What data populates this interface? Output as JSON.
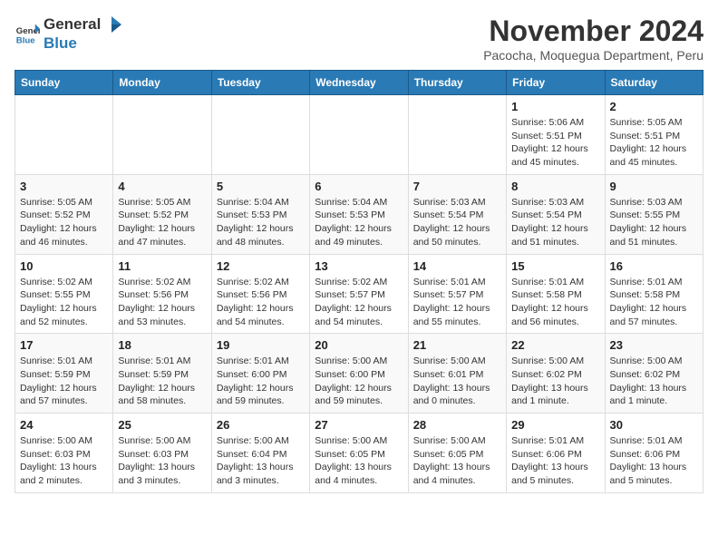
{
  "logo": {
    "general": "General",
    "blue": "Blue"
  },
  "title": "November 2024",
  "subtitle": "Pacocha, Moquegua Department, Peru",
  "days_of_week": [
    "Sunday",
    "Monday",
    "Tuesday",
    "Wednesday",
    "Thursday",
    "Friday",
    "Saturday"
  ],
  "weeks": [
    [
      {
        "day": "",
        "info": ""
      },
      {
        "day": "",
        "info": ""
      },
      {
        "day": "",
        "info": ""
      },
      {
        "day": "",
        "info": ""
      },
      {
        "day": "",
        "info": ""
      },
      {
        "day": "1",
        "info": "Sunrise: 5:06 AM\nSunset: 5:51 PM\nDaylight: 12 hours\nand 45 minutes."
      },
      {
        "day": "2",
        "info": "Sunrise: 5:05 AM\nSunset: 5:51 PM\nDaylight: 12 hours\nand 45 minutes."
      }
    ],
    [
      {
        "day": "3",
        "info": "Sunrise: 5:05 AM\nSunset: 5:52 PM\nDaylight: 12 hours\nand 46 minutes."
      },
      {
        "day": "4",
        "info": "Sunrise: 5:05 AM\nSunset: 5:52 PM\nDaylight: 12 hours\nand 47 minutes."
      },
      {
        "day": "5",
        "info": "Sunrise: 5:04 AM\nSunset: 5:53 PM\nDaylight: 12 hours\nand 48 minutes."
      },
      {
        "day": "6",
        "info": "Sunrise: 5:04 AM\nSunset: 5:53 PM\nDaylight: 12 hours\nand 49 minutes."
      },
      {
        "day": "7",
        "info": "Sunrise: 5:03 AM\nSunset: 5:54 PM\nDaylight: 12 hours\nand 50 minutes."
      },
      {
        "day": "8",
        "info": "Sunrise: 5:03 AM\nSunset: 5:54 PM\nDaylight: 12 hours\nand 51 minutes."
      },
      {
        "day": "9",
        "info": "Sunrise: 5:03 AM\nSunset: 5:55 PM\nDaylight: 12 hours\nand 51 minutes."
      }
    ],
    [
      {
        "day": "10",
        "info": "Sunrise: 5:02 AM\nSunset: 5:55 PM\nDaylight: 12 hours\nand 52 minutes."
      },
      {
        "day": "11",
        "info": "Sunrise: 5:02 AM\nSunset: 5:56 PM\nDaylight: 12 hours\nand 53 minutes."
      },
      {
        "day": "12",
        "info": "Sunrise: 5:02 AM\nSunset: 5:56 PM\nDaylight: 12 hours\nand 54 minutes."
      },
      {
        "day": "13",
        "info": "Sunrise: 5:02 AM\nSunset: 5:57 PM\nDaylight: 12 hours\nand 54 minutes."
      },
      {
        "day": "14",
        "info": "Sunrise: 5:01 AM\nSunset: 5:57 PM\nDaylight: 12 hours\nand 55 minutes."
      },
      {
        "day": "15",
        "info": "Sunrise: 5:01 AM\nSunset: 5:58 PM\nDaylight: 12 hours\nand 56 minutes."
      },
      {
        "day": "16",
        "info": "Sunrise: 5:01 AM\nSunset: 5:58 PM\nDaylight: 12 hours\nand 57 minutes."
      }
    ],
    [
      {
        "day": "17",
        "info": "Sunrise: 5:01 AM\nSunset: 5:59 PM\nDaylight: 12 hours\nand 57 minutes."
      },
      {
        "day": "18",
        "info": "Sunrise: 5:01 AM\nSunset: 5:59 PM\nDaylight: 12 hours\nand 58 minutes."
      },
      {
        "day": "19",
        "info": "Sunrise: 5:01 AM\nSunset: 6:00 PM\nDaylight: 12 hours\nand 59 minutes."
      },
      {
        "day": "20",
        "info": "Sunrise: 5:00 AM\nSunset: 6:00 PM\nDaylight: 12 hours\nand 59 minutes."
      },
      {
        "day": "21",
        "info": "Sunrise: 5:00 AM\nSunset: 6:01 PM\nDaylight: 13 hours\nand 0 minutes."
      },
      {
        "day": "22",
        "info": "Sunrise: 5:00 AM\nSunset: 6:02 PM\nDaylight: 13 hours\nand 1 minute."
      },
      {
        "day": "23",
        "info": "Sunrise: 5:00 AM\nSunset: 6:02 PM\nDaylight: 13 hours\nand 1 minute."
      }
    ],
    [
      {
        "day": "24",
        "info": "Sunrise: 5:00 AM\nSunset: 6:03 PM\nDaylight: 13 hours\nand 2 minutes."
      },
      {
        "day": "25",
        "info": "Sunrise: 5:00 AM\nSunset: 6:03 PM\nDaylight: 13 hours\nand 3 minutes."
      },
      {
        "day": "26",
        "info": "Sunrise: 5:00 AM\nSunset: 6:04 PM\nDaylight: 13 hours\nand 3 minutes."
      },
      {
        "day": "27",
        "info": "Sunrise: 5:00 AM\nSunset: 6:05 PM\nDaylight: 13 hours\nand 4 minutes."
      },
      {
        "day": "28",
        "info": "Sunrise: 5:00 AM\nSunset: 6:05 PM\nDaylight: 13 hours\nand 4 minutes."
      },
      {
        "day": "29",
        "info": "Sunrise: 5:01 AM\nSunset: 6:06 PM\nDaylight: 13 hours\nand 5 minutes."
      },
      {
        "day": "30",
        "info": "Sunrise: 5:01 AM\nSunset: 6:06 PM\nDaylight: 13 hours\nand 5 minutes."
      }
    ]
  ]
}
